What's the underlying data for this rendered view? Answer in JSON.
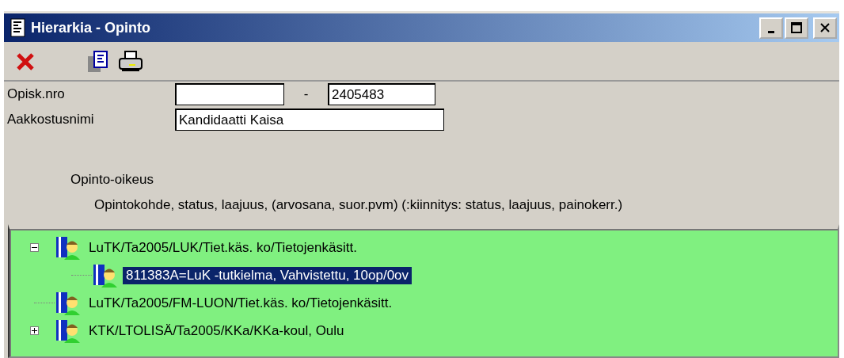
{
  "window": {
    "title": "Hierarkia - Opinto"
  },
  "form": {
    "student_number": {
      "label": "Opisk.nro",
      "separator": "-",
      "value": "2405483"
    },
    "sort_name": {
      "label": "Aakkostusnimi",
      "value": "Kandidaatti Kaisa"
    }
  },
  "legend": {
    "heading": "Opinto-oikeus",
    "columns": "Opintokohde, status, laajuus, (arvosana, suor.pvm) (:kiinnitys: status, laajuus, painokerr.)"
  },
  "tree": [
    {
      "label": "LuTK/Ta2005/LUK/Tiet.käs. ko/Tietojenkäsitt.",
      "expanded": true,
      "selected": false,
      "children": [
        {
          "label": "811383A=LuK -tutkielma, Vahvistettu, 10op/0ov",
          "selected": true
        }
      ]
    },
    {
      "label": "LuTK/Ta2005/FM-LUON/Tiet.käs. ko/Tietojenkäsitt.",
      "selected": false
    },
    {
      "label": "KTK/LTOLISÄ/Ta2005/KKa/KKa-koul, Oulu",
      "expanded": false,
      "selected": false
    }
  ]
}
